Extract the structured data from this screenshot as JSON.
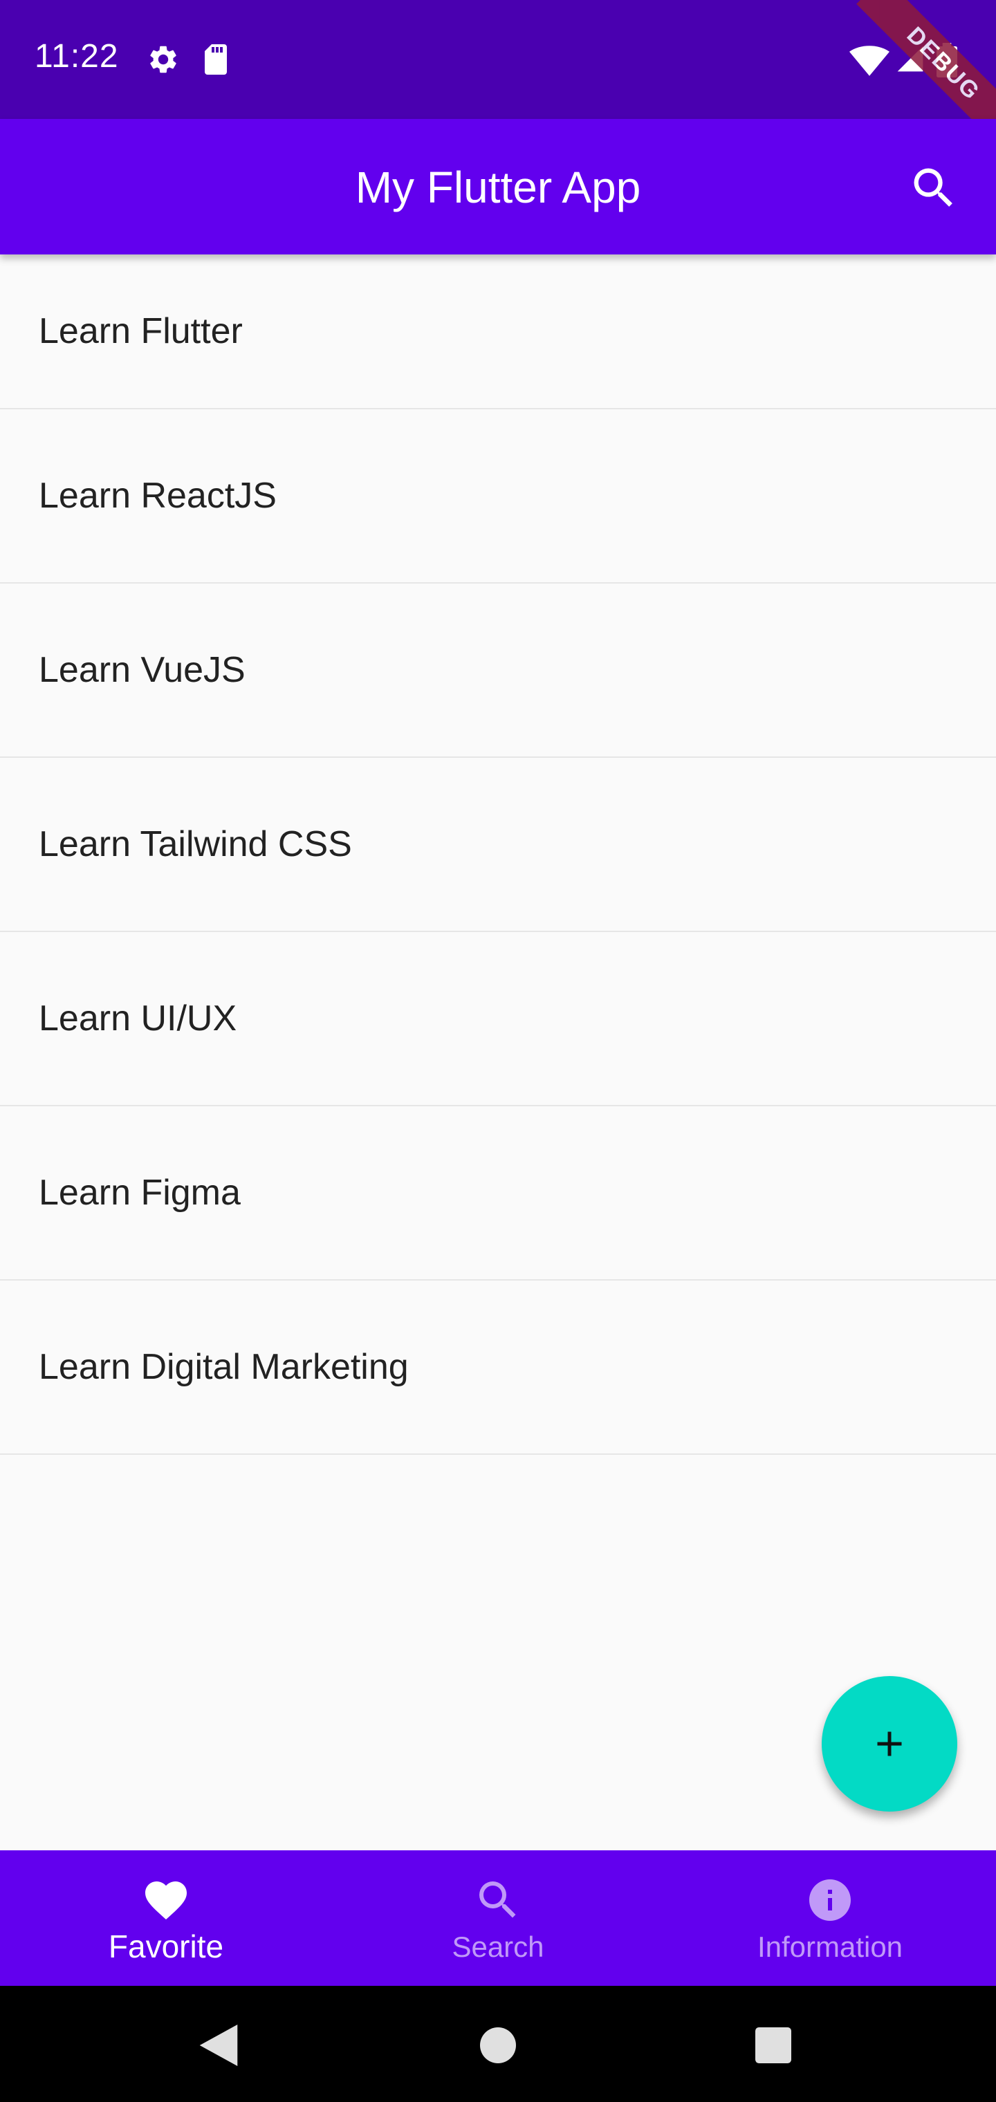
{
  "status_bar": {
    "time": "11:22",
    "debug_label": "DEBUG",
    "icons": [
      "gear-icon",
      "sd-card-icon",
      "wifi-icon",
      "signal-icon",
      "battery-icon"
    ]
  },
  "app_bar": {
    "title": "My Flutter App",
    "action_icon": "search-icon"
  },
  "list": {
    "items": [
      {
        "label": "Learn Flutter"
      },
      {
        "label": "Learn ReactJS"
      },
      {
        "label": "Learn VueJS"
      },
      {
        "label": "Learn Tailwind CSS"
      },
      {
        "label": "Learn UI/UX"
      },
      {
        "label": "Learn Figma"
      },
      {
        "label": "Learn Digital Marketing"
      }
    ]
  },
  "fab": {
    "icon": "plus-icon"
  },
  "bottom_nav": {
    "items": [
      {
        "label": "Favorite",
        "icon": "heart-icon",
        "active": true
      },
      {
        "label": "Search",
        "icon": "search-icon",
        "active": false
      },
      {
        "label": "Information",
        "icon": "info-icon",
        "active": false
      }
    ]
  },
  "colors": {
    "status_bar": "#4a00b0",
    "primary": "#6200ee",
    "fab": "#03dac5",
    "background": "#fafafa",
    "debug_banner": "#8e1a3c"
  }
}
